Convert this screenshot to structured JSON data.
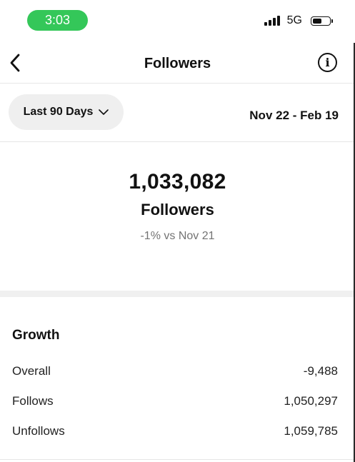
{
  "status_bar": {
    "time": "3:03",
    "network": "5G",
    "time_pill_color": "#34c759",
    "battery_level": 0.6
  },
  "nav": {
    "title": "Followers",
    "back_icon": "chevron-left-icon",
    "info_icon": "info-icon",
    "info_glyph": "i"
  },
  "filter": {
    "range_label": "Last 90 Days",
    "date_range": "Nov 22 - Feb 19"
  },
  "summary": {
    "count": "1,033,082",
    "label": "Followers",
    "delta": "-1% vs Nov 21"
  },
  "growth": {
    "title": "Growth",
    "rows": [
      {
        "label": "Overall",
        "value": "-9,488"
      },
      {
        "label": "Follows",
        "value": "1,050,297"
      },
      {
        "label": "Unfollows",
        "value": "1,059,785"
      }
    ]
  }
}
